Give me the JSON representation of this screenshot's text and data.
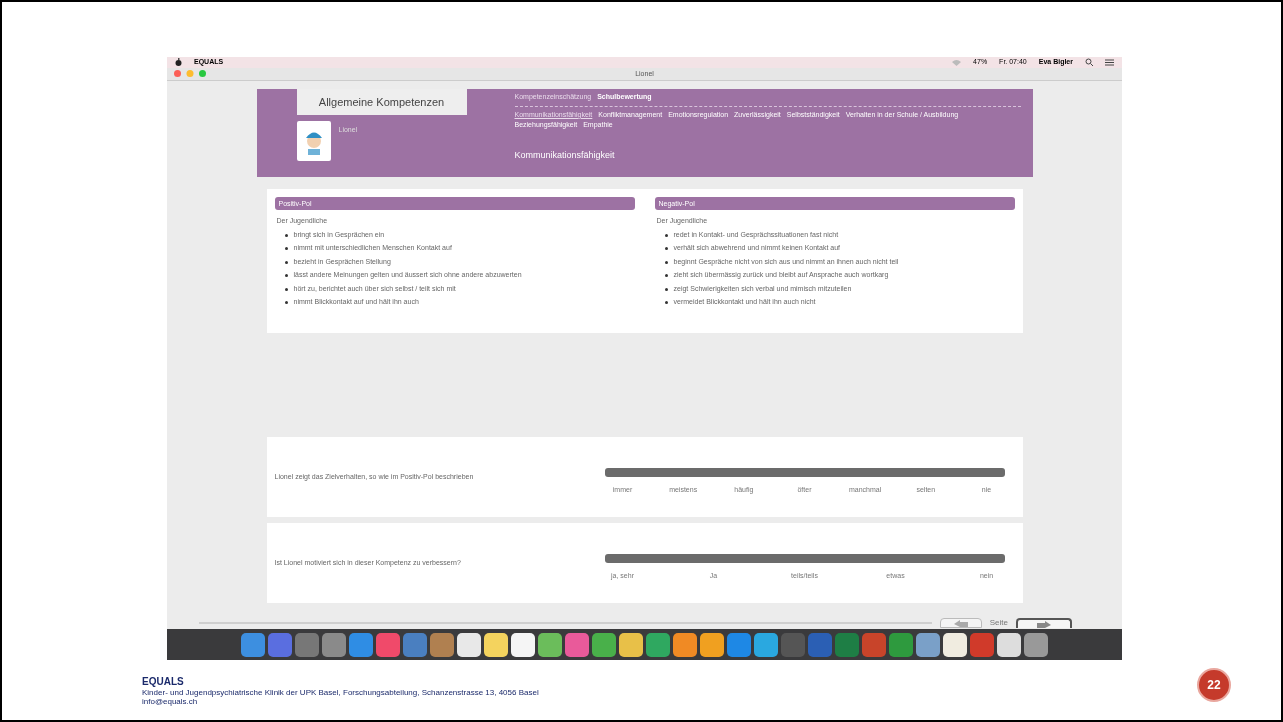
{
  "menu_bar": {
    "app": "EQUALS",
    "battery": "47%",
    "clock": "Fr. 07:40",
    "user": "Eva Bigler"
  },
  "window": {
    "title": "Lionel"
  },
  "header": {
    "section_tab": "Allgemeine Kompetenzen",
    "student": "Lionel",
    "nav_top": [
      {
        "label": "Kompetenzeinschätzung",
        "selected": false
      },
      {
        "label": "Schulbewertung",
        "selected": true
      }
    ],
    "nav_competences": [
      {
        "label": "Kommunikationsfähigkeit",
        "selected": true
      },
      {
        "label": "Konfliktmanagement",
        "selected": false
      },
      {
        "label": "Emotionsregulation",
        "selected": false
      },
      {
        "label": "Zuverlässigkeit",
        "selected": false
      },
      {
        "label": "Selbstständigkeit",
        "selected": false
      },
      {
        "label": "Verhalten in der Schule / Ausbildung",
        "selected": false
      },
      {
        "label": "Beziehungsfähigkeit",
        "selected": false
      },
      {
        "label": "Empathie",
        "selected": false
      }
    ],
    "heading": "Kommunikationsfähigkeit"
  },
  "poles": [
    {
      "title": "Positiv-Pol",
      "intro": "Der Jugendliche",
      "items": [
        "bringt sich in Gesprächen ein",
        "nimmt mit unterschiedlichen Menschen Kontakt auf",
        "bezieht in Gesprächen Stellung",
        "lässt andere Meinungen gelten und äussert sich ohne andere abzuwerten",
        "hört zu, berichtet auch über sich selbst / teilt sich mit",
        "nimmt Blickkontakt auf und hält ihn auch"
      ]
    },
    {
      "title": "Negativ-Pol",
      "intro": "Der Jugendliche",
      "items": [
        "redet in Kontakt- und Gesprächssituationen fast nicht",
        "verhält sich abwehrend und nimmt keinen Kontakt auf",
        "beginnt Gespräche nicht von sich aus und nimmt an ihnen auch nicht teil",
        "zieht sich übermässig zurück und bleibt auf Ansprache auch wortkarg",
        "zeigt Schwierigkeiten sich verbal und mimisch mitzuteilen",
        "vermeidet Blickkontakt und hält ihn auch nicht"
      ]
    }
  ],
  "questions": [
    {
      "text": "Lionel zeigt das Zielverhalten, so wie im Positiv-Pol beschrieben",
      "scale": [
        "immer",
        "meistens",
        "häufig",
        "öfter",
        "manchmal",
        "selten",
        "nie"
      ]
    },
    {
      "text": "Ist Lionel motiviert sich in dieser Kompetenz zu verbessern?",
      "scale": [
        "ja, sehr",
        "Ja",
        "teils/teils",
        "etwas",
        "nein"
      ]
    }
  ],
  "pager": {
    "label": "Seite"
  },
  "footer": {
    "org": "EQUALS",
    "address": "Kinder- und Jugendpsychiatrische Klinik der UPK Basel, Forschungsabteilung, Schanzenstrasse 13, 4056 Basel",
    "email": "info@equals.ch",
    "page": "22"
  }
}
